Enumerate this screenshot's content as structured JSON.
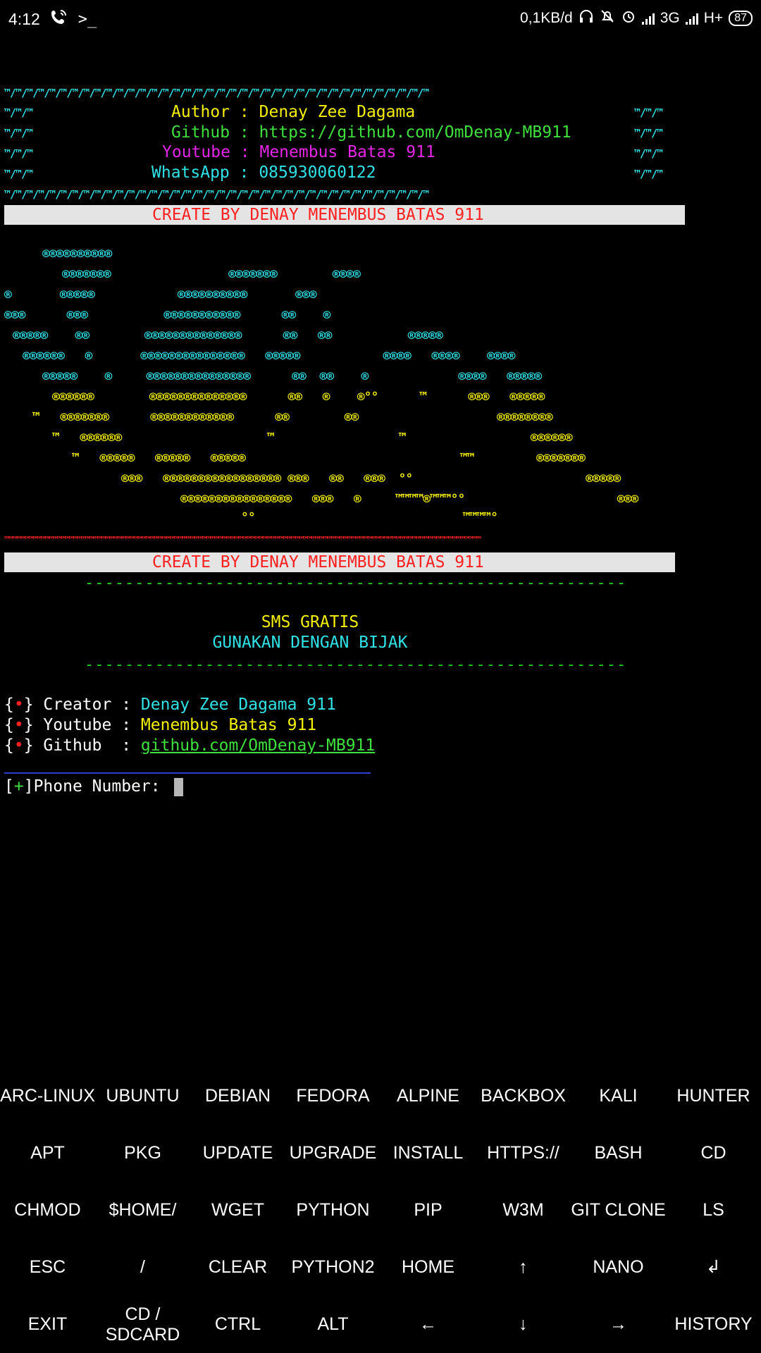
{
  "status_bar": {
    "time": "4:12",
    "terminal_glyph": ">_",
    "network_speed": "0,1KB/d",
    "net_type_1": "3G",
    "net_type_2": "H+",
    "battery": "87"
  },
  "header": {
    "tm_row": "™/™/™/™/™/™/™/™/™/™/™/™/™/™/™/™/™/™/™/™/™/™/™/™/™/™/™/™/™/™/™/™/™/™/™/™/™/™",
    "tm_side": "™/™/™",
    "author_label": "Author : ",
    "author_value": "Denay Zee Dagama",
    "github_label": "Github : ",
    "github_value": "https://github.com/OmDenay-MB911",
    "youtube_label": "Youtube : ",
    "youtube_value": "Menembus Batas 911",
    "whatsapp_label": "WhatsApp : ",
    "whatsapp_value": "085930060122",
    "banner": "CREATE BY DENAY MENEMBUS BATAS 911"
  },
  "ascii_art": {
    "red_row": "™™™™™™™™™™™™™™™™™™™™™™™™™™™™™™™™™™™™™™™™™™™™™™™™™™™™™™™™™™™™™™™™™™™™™™™™™™™™™™™™™™™™™™™™™™™™™™™™™™™™™™™™™™™™™™™™™™™™™™",
    "banner": "CREATE BY DENAY MENEMBUS BATAS 911"
  },
  "menu": {
    "dash_line": "------------------------------------------------------",
    "title": "SMS GRATIS",
    "subtitle": "GUNAKAN DENGAN BIJAK",
    "bullet": "•",
    "creator_label": "Creator : ",
    "creator_value": "Denay Zee Dagama 911",
    "youtube_label": "Youtube : ",
    "youtube_value": "Menembus Batas 911",
    "github_label": "Github  : ",
    "github_value": "github.com/OmDenay-MB911",
    "prompt_prefix": "[+]",
    "prompt_label": "Phone Number: "
  },
  "extra_keys": [
    [
      "ARC-LINUX",
      "UBUNTU",
      "DEBIAN",
      "FEDORA",
      "ALPINE",
      "BACKBOX",
      "KALI",
      "HUNTER"
    ],
    [
      "APT",
      "PKG",
      "UPDATE",
      "UPGRADE",
      "INSTALL",
      "HTTPS://",
      "BASH",
      "CD"
    ],
    [
      "CHMOD",
      "$HOME/",
      "WGET",
      "PYTHON",
      "PIP",
      "W3M",
      "GIT CLONE",
      "LS"
    ],
    [
      "ESC",
      "/",
      "CLEAR",
      "PYTHON2",
      "HOME",
      "↑",
      "NANO",
      "↲"
    ],
    [
      "EXIT",
      "CD /\nSDCARD",
      "CTRL",
      "ALT",
      "←",
      "↓",
      "→",
      "HISTORY"
    ]
  ]
}
